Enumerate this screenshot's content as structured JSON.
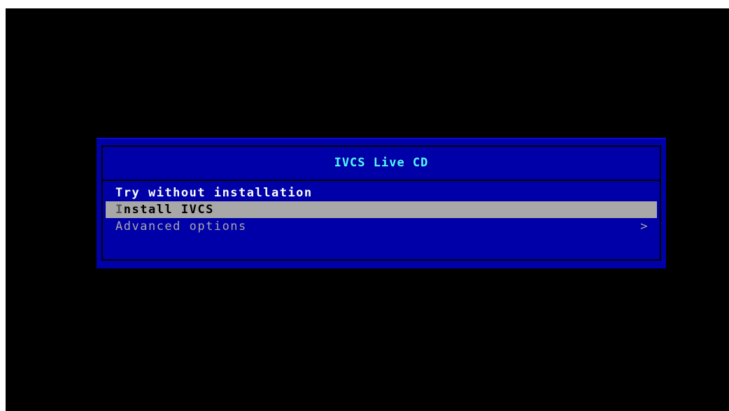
{
  "boot_menu": {
    "title": "IVCS Live CD",
    "items": [
      {
        "hotkey": "T",
        "rest": "ry without installation"
      },
      {
        "hotkey": "I",
        "rest": "nstall IVCS"
      },
      {
        "hotkey": "A",
        "rest": "dvanced options",
        "submenu_indicator": ">"
      }
    ],
    "selected_index": 1
  },
  "colors": {
    "screen_background": "#000000",
    "menu_background": "#0000a8",
    "title_text": "#54fcfc",
    "item_text": "#a8a8a8",
    "highlight_background": "#a8a8a8",
    "highlight_text": "#000000"
  }
}
